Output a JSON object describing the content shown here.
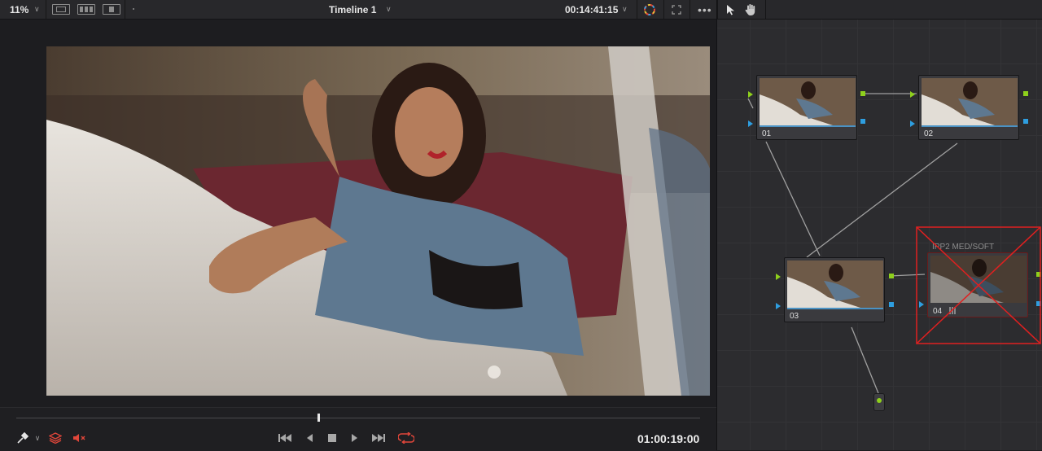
{
  "toolbar": {
    "zoom": "11%",
    "timeline_name": "Timeline 1",
    "timecode": "00:14:41:15"
  },
  "viewer": {
    "timecode": "01:00:19:00",
    "playhead_position": 0.44
  },
  "nodes": [
    {
      "label": "01"
    },
    {
      "label": "02"
    },
    {
      "label": "03"
    },
    {
      "label": "04",
      "title": "IPP2 MED/SOFT",
      "disabled": true
    }
  ],
  "colors": {
    "accent_red": "#e0463a",
    "input_green": "#8ed01c",
    "input_blue": "#2e9ee0",
    "disabled_x": "#e02020"
  },
  "icons": {
    "zoom_dropdown": "chevron-down-icon",
    "single_viewer": "single-viewer-icon",
    "gallery_view": "gallery-view-icon",
    "cinema_view": "cinema-view-icon",
    "timeline_dropdown": "chevron-down-icon",
    "timecode_dropdown": "chevron-down-icon",
    "highlight": "color-picker-wheel-icon",
    "expand": "expand-icon",
    "more": "more-options-icon",
    "pointer": "pointer-icon",
    "hand": "hand-icon",
    "eyedropper": "eyedropper-icon",
    "layers": "layers-icon",
    "mute": "speaker-mute-icon",
    "first_frame": "skip-to-start-icon",
    "reverse": "play-reverse-icon",
    "stop": "stop-icon",
    "play": "play-icon",
    "last_frame": "skip-to-end-icon",
    "loop": "loop-icon"
  }
}
